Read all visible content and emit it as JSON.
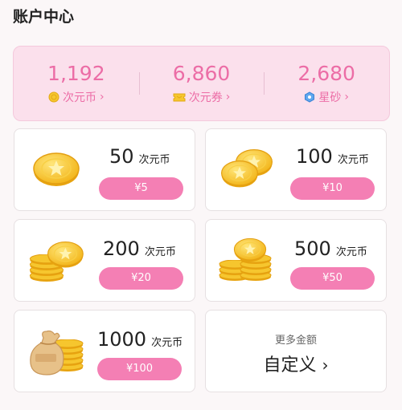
{
  "page": {
    "title": "账户中心"
  },
  "balances": [
    {
      "value": "1,192",
      "label": "次元币",
      "icon": "coin-icon"
    },
    {
      "value": "6,860",
      "label": "次元券",
      "icon": "ticket-icon"
    },
    {
      "value": "2,680",
      "label": "星砂",
      "icon": "star-sand-icon"
    }
  ],
  "chevron": "›",
  "packages": [
    {
      "amount": "50",
      "unit": "次元币",
      "price": "¥5"
    },
    {
      "amount": "100",
      "unit": "次元币",
      "price": "¥10"
    },
    {
      "amount": "200",
      "unit": "次元币",
      "price": "¥20"
    },
    {
      "amount": "500",
      "unit": "次元币",
      "price": "¥50"
    },
    {
      "amount": "1000",
      "unit": "次元币",
      "price": "¥100"
    }
  ],
  "custom": {
    "subtitle": "更多金额",
    "label": "自定义",
    "chevron": "›"
  },
  "colors": {
    "accent": "#f47fb4",
    "balance_text": "#ec6da6",
    "balance_bg": "#fbe0ec"
  }
}
